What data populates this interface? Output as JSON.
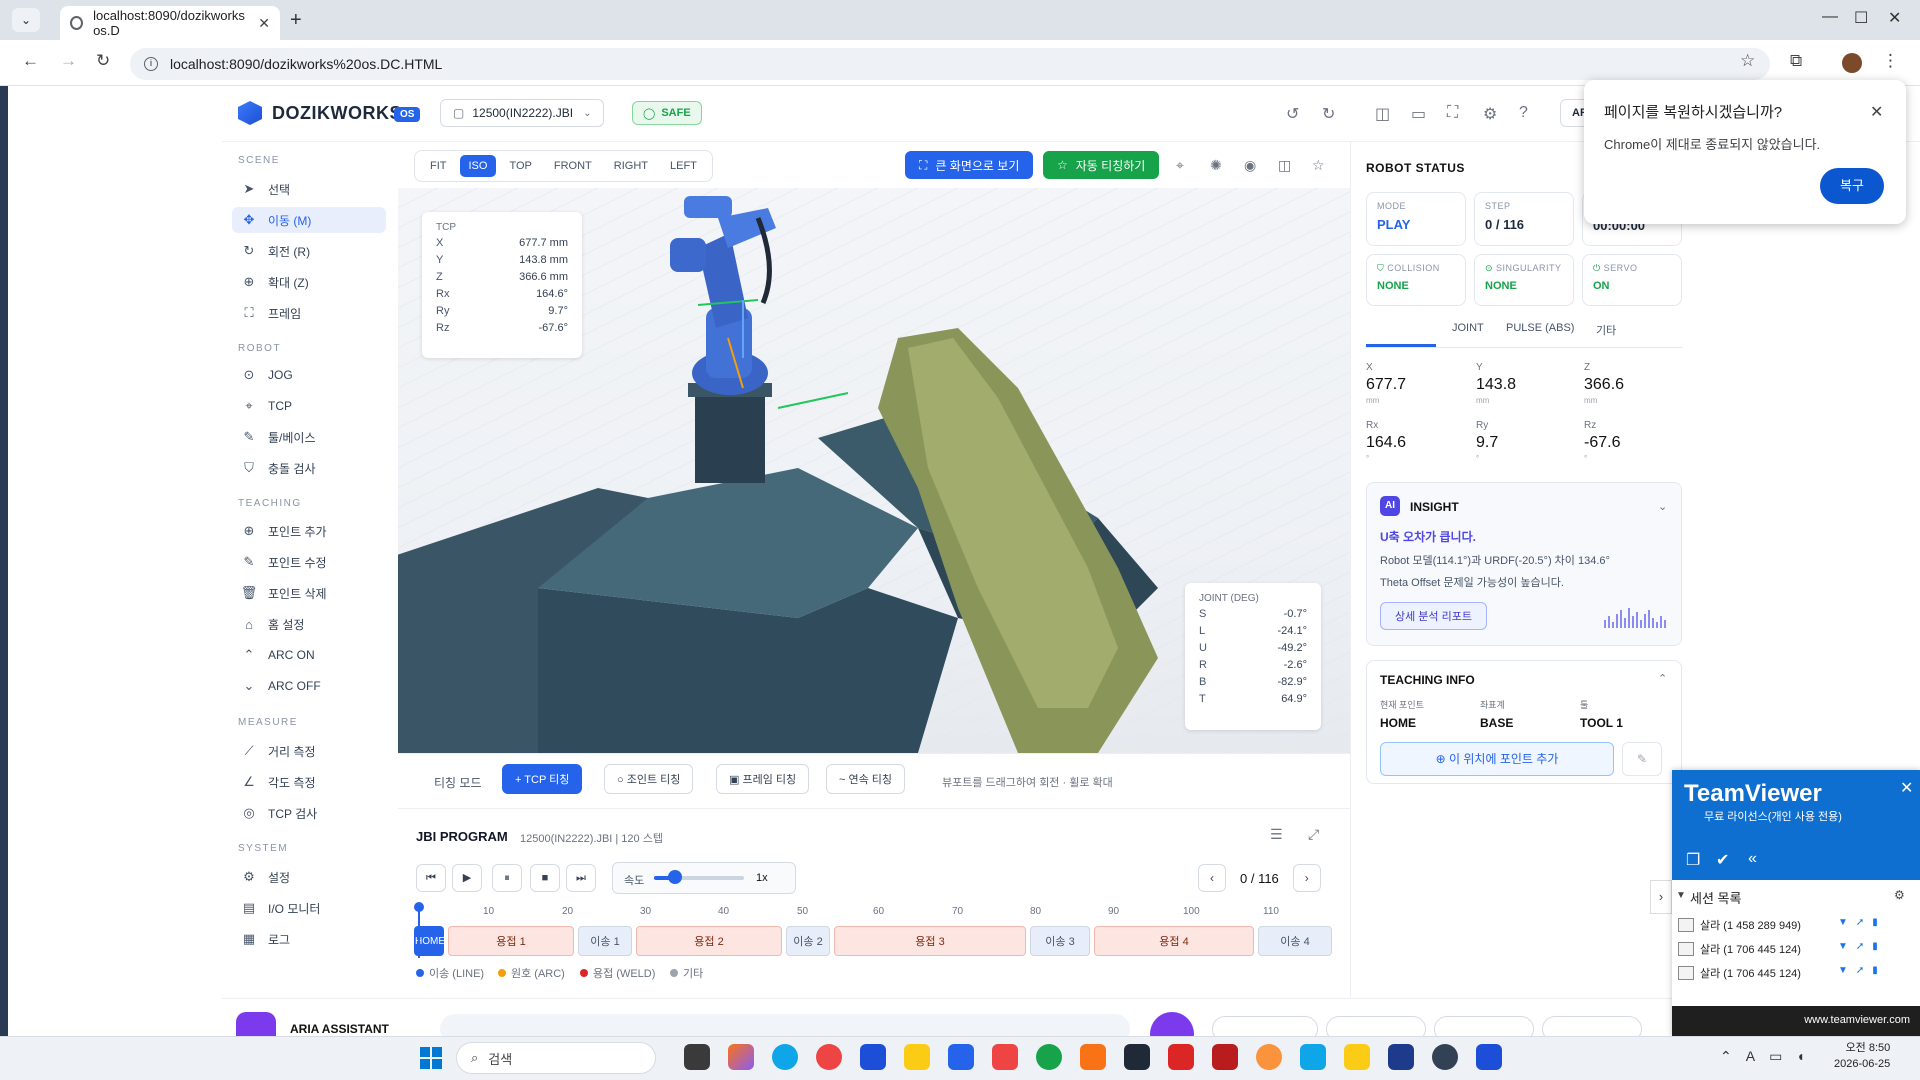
{
  "browser": {
    "tab_title": "localhost:8090/dozikworks os.D",
    "url": "localhost:8090/dozikworks%20os.DC.HTML"
  },
  "header": {
    "brand": "DOZIKWORKS",
    "brand_badge": "OS",
    "file": "12500(IN2222).JBI",
    "safe": "SAFE",
    "ar_label": "AR"
  },
  "sidebar": {
    "scene_label": "SCENE",
    "scene": [
      {
        "label": "선택",
        "icon": "cursor-icon"
      },
      {
        "label": "이동 (M)",
        "icon": "move-icon"
      },
      {
        "label": "회전 (R)",
        "icon": "rotate-icon"
      },
      {
        "label": "확대 (Z)",
        "icon": "zoom-icon"
      },
      {
        "label": "프레임",
        "icon": "frame-icon"
      }
    ],
    "robot_label": "ROBOT",
    "robot": [
      {
        "label": "JOG",
        "icon": "jog-icon"
      },
      {
        "label": "TCP",
        "icon": "tcp-icon"
      },
      {
        "label": "툴/베이스",
        "icon": "wrench-icon"
      },
      {
        "label": "충돌 검사",
        "icon": "shield-icon"
      }
    ],
    "teaching_label": "TEACHING",
    "teaching": [
      {
        "label": "포인트 추가",
        "icon": "plus-circle-icon"
      },
      {
        "label": "포인트 수정",
        "icon": "edit-icon"
      },
      {
        "label": "포인트 삭제",
        "icon": "trash-icon"
      },
      {
        "label": "홈 설정",
        "icon": "home-icon"
      },
      {
        "label": "ARC ON",
        "icon": "arc-on-icon"
      },
      {
        "label": "ARC OFF",
        "icon": "arc-off-icon"
      }
    ],
    "measure_label": "MEASURE",
    "measure": [
      {
        "label": "거리 측정",
        "icon": "ruler-icon"
      },
      {
        "label": "각도 측정",
        "icon": "angle-icon"
      },
      {
        "label": "TCP 검사",
        "icon": "target-icon"
      }
    ],
    "system_label": "SYSTEM",
    "system": [
      {
        "label": "설정",
        "icon": "gear-icon"
      },
      {
        "label": "I/O 모니터",
        "icon": "monitor-icon"
      },
      {
        "label": "로그",
        "icon": "log-icon"
      }
    ]
  },
  "viewport": {
    "views": [
      "FIT",
      "ISO",
      "TOP",
      "FRONT",
      "RIGHT",
      "LEFT"
    ],
    "active_view": "ISO",
    "big_screen": "큰 화면으로 보기",
    "auto_teach": "자동 티칭하기",
    "tcp": {
      "title": "TCP",
      "rows": [
        {
          "k": "X",
          "v": "677.7 mm"
        },
        {
          "k": "Y",
          "v": "143.8 mm"
        },
        {
          "k": "Z",
          "v": "366.6 mm"
        },
        {
          "k": "Rx",
          "v": "164.6°"
        },
        {
          "k": "Ry",
          "v": "9.7°"
        },
        {
          "k": "Rz",
          "v": "-67.6°"
        }
      ]
    },
    "joint": {
      "title": "JOINT (DEG)",
      "rows": [
        {
          "k": "S",
          "v": "-0.7°"
        },
        {
          "k": "L",
          "v": "-24.1°"
        },
        {
          "k": "U",
          "v": "-49.2°"
        },
        {
          "k": "R",
          "v": "-2.6°"
        },
        {
          "k": "B",
          "v": "-82.9°"
        },
        {
          "k": "T",
          "v": "64.9°"
        }
      ]
    }
  },
  "teach_bar": {
    "label": "티칭 모드",
    "buttons": [
      "+ TCP 티칭",
      "○ 조인트 티칭",
      "▣ 프레임 티칭",
      "~ 연속 티칭"
    ],
    "hint": "뷰포트를 드래그하여 회전 · 휠로 확대"
  },
  "program": {
    "title": "JBI PROGRAM",
    "subtitle": "12500(IN2222).JBI | 120 스텝",
    "speed_label": "속도",
    "speed_value": "1x",
    "speed_fraction": 0.2,
    "step": "0 / 116",
    "ticks": [
      "10",
      "20",
      "30",
      "40",
      "50",
      "60",
      "70",
      "80",
      "90",
      "100",
      "110"
    ],
    "segments": [
      {
        "label": "HOME",
        "type": "home"
      },
      {
        "label": "용접 1",
        "type": "weld"
      },
      {
        "label": "이송 1",
        "type": "line"
      },
      {
        "label": "용접 2",
        "type": "weld"
      },
      {
        "label": "이송 2",
        "type": "line"
      },
      {
        "label": "용접 3",
        "type": "weld"
      },
      {
        "label": "이송 3",
        "type": "line"
      },
      {
        "label": "용접 4",
        "type": "weld"
      },
      {
        "label": "이송 4",
        "type": "line"
      }
    ],
    "legend": [
      {
        "label": "이송 (LINE)",
        "color": "#2563eb"
      },
      {
        "label": "원호 (ARC)",
        "color": "#f59e0b"
      },
      {
        "label": "용접 (WELD)",
        "color": "#dc2626"
      },
      {
        "label": "기타",
        "color": "#9ca3af"
      }
    ]
  },
  "assistant": {
    "label": "ARIA ASSISTANT"
  },
  "robot_status": {
    "title": "ROBOT STATUS",
    "mode_label": "MODE",
    "mode": "PLAY",
    "step_label": "STEP",
    "step": "0 / 116",
    "time": "00:00:00",
    "collision_label": "COLLISION",
    "collision": "NONE",
    "singularity_label": "SINGULARITY",
    "singularity": "NONE",
    "servo_label": "SERVO",
    "servo": "ON",
    "tabs": [
      "JOINT",
      "PULSE (ABS)",
      "기타"
    ],
    "axes": [
      {
        "k": "X",
        "v": "677.7",
        "u": "mm"
      },
      {
        "k": "Y",
        "v": "143.8",
        "u": "mm"
      },
      {
        "k": "Z",
        "v": "366.6",
        "u": "mm"
      },
      {
        "k": "Rx",
        "v": "164.6",
        "u": "°"
      },
      {
        "k": "Ry",
        "v": "9.7",
        "u": "°"
      },
      {
        "k": "Rz",
        "v": "-67.6",
        "u": "°"
      }
    ]
  },
  "insight": {
    "badge": "AI",
    "title": "INSIGHT",
    "headline": "U축 오차가 큽니다.",
    "line1": "Robot 모델(114.1°)과 URDF(-20.5°) 차이 134.6°",
    "line2": "Theta Offset 문제일 가능성이 높습니다.",
    "button": "상세 분석 리포트"
  },
  "teaching_info": {
    "title": "TEACHING INFO",
    "point_label": "현재 포인트",
    "point": "HOME",
    "coord_label": "좌표계",
    "coord": "BASE",
    "tool_label": "툴",
    "tool": "TOOL 1",
    "add_button": "이 위치에 포인트 추가"
  },
  "restore_popup": {
    "title": "페이지를 복원하시겠습니까?",
    "body": "Chrome이 제대로 종료되지 않았습니다.",
    "button": "복구"
  },
  "teamviewer": {
    "logo": "TeamViewer",
    "subtitle": "무료 라이선스(개인 사용 전용)",
    "sessions_label": "세션 목록",
    "sessions": [
      "살라 (1 458 289 949)",
      "살라 (1 706 445 124)",
      "살라 (1 706 445 124)"
    ],
    "footer": "www.teamviewer.com"
  },
  "taskbar": {
    "search": "검색",
    "time": "오전 8:50",
    "date": "2026-06-25"
  }
}
